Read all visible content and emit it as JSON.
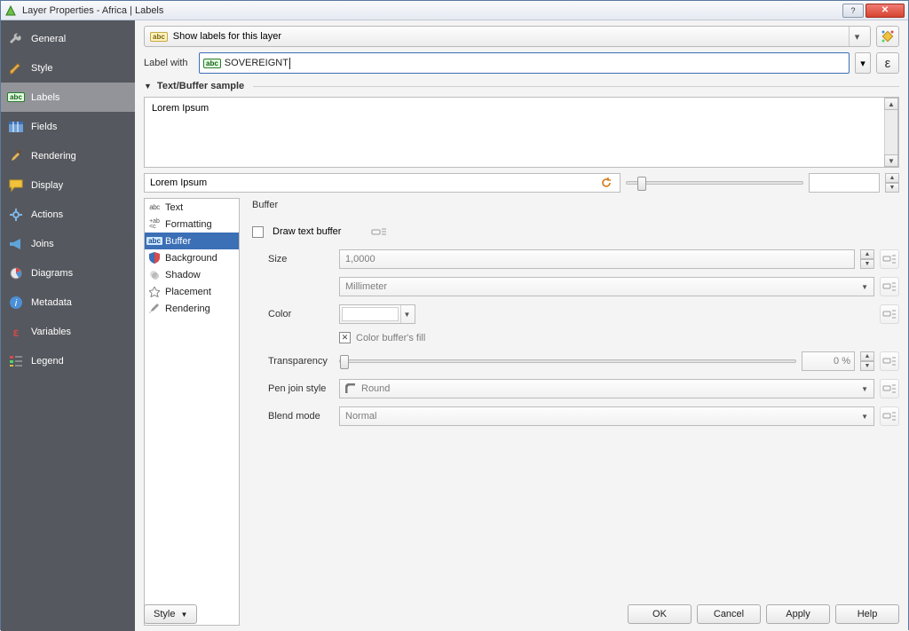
{
  "window": {
    "title": "Layer Properties - Africa | Labels"
  },
  "sidebar": {
    "items": [
      {
        "label": "General"
      },
      {
        "label": "Style"
      },
      {
        "label": "Labels"
      },
      {
        "label": "Fields"
      },
      {
        "label": "Rendering"
      },
      {
        "label": "Display"
      },
      {
        "label": "Actions"
      },
      {
        "label": "Joins"
      },
      {
        "label": "Diagrams"
      },
      {
        "label": "Metadata"
      },
      {
        "label": "Variables"
      },
      {
        "label": "Legend"
      }
    ]
  },
  "header": {
    "show_labels_text": "Show labels for this layer",
    "label_with_label": "Label with",
    "label_with_value": "SOVEREIGNT",
    "label_with_prefix": "abc",
    "expr_glyph": "ε"
  },
  "sample": {
    "section_title": "Text/Buffer sample",
    "preview_text": "Lorem Ipsum",
    "input_value": "Lorem Ipsum"
  },
  "subnav": {
    "items": [
      {
        "label": "Text"
      },
      {
        "label": "Formatting"
      },
      {
        "label": "Buffer"
      },
      {
        "label": "Background"
      },
      {
        "label": "Shadow"
      },
      {
        "label": "Placement"
      },
      {
        "label": "Rendering"
      }
    ]
  },
  "buffer": {
    "title": "Buffer",
    "draw_label": "Draw text buffer",
    "draw_checked": false,
    "size_label": "Size",
    "size_value": "1,0000",
    "size_unit": "Millimeter",
    "color_label": "Color",
    "color_fill_label": "Color buffer's fill",
    "transparency_label": "Transparency",
    "transparency_value": "0 %",
    "penjoin_label": "Pen join style",
    "penjoin_value": "Round",
    "blend_label": "Blend mode",
    "blend_value": "Normal"
  },
  "buttons": {
    "style": "Style",
    "ok": "OK",
    "cancel": "Cancel",
    "apply": "Apply",
    "help": "Help"
  }
}
